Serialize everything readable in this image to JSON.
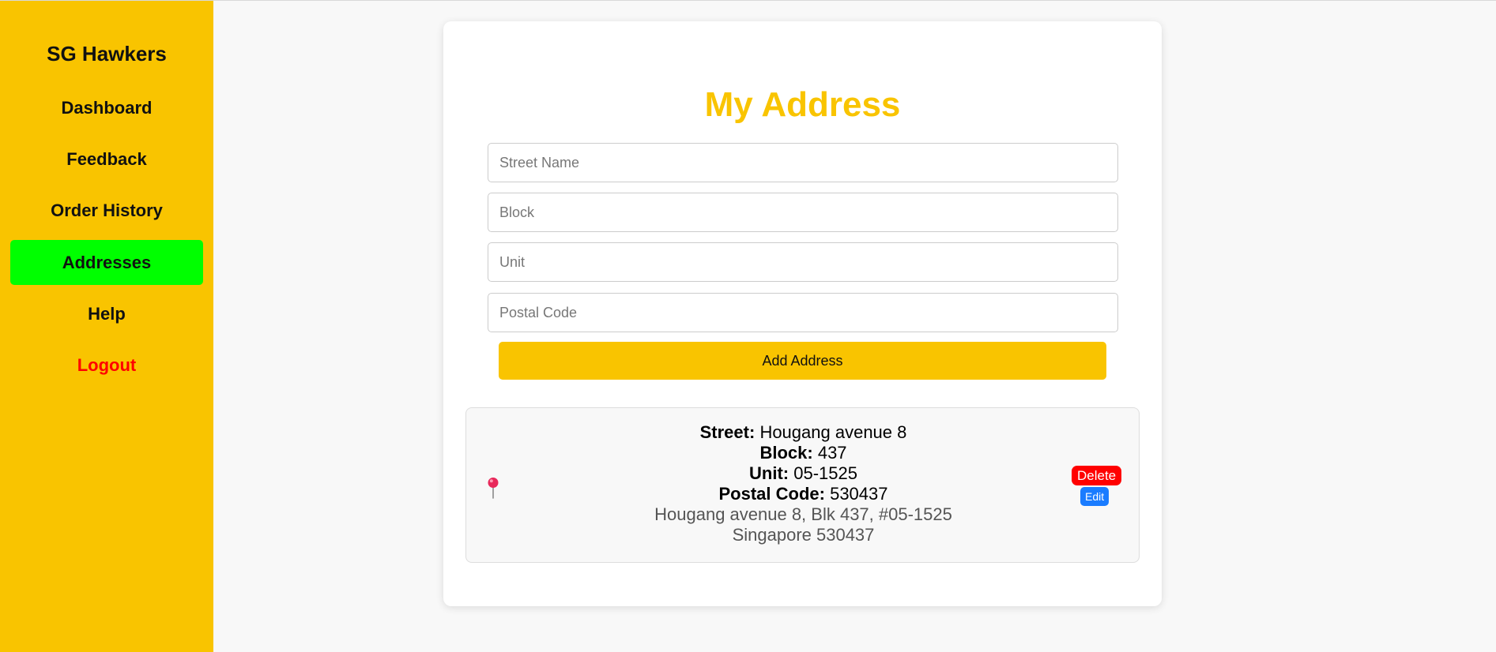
{
  "sidebar": {
    "brand": "SG Hawkers",
    "items": [
      {
        "label": "Dashboard"
      },
      {
        "label": "Feedback"
      },
      {
        "label": "Order History"
      },
      {
        "label": "Addresses",
        "active": true
      },
      {
        "label": "Help"
      },
      {
        "label": "Logout"
      }
    ]
  },
  "main": {
    "title": "My Address",
    "form": {
      "street_placeholder": "Street Name",
      "block_placeholder": "Block",
      "unit_placeholder": "Unit",
      "postal_placeholder": "Postal Code",
      "submit_label": "Add Address"
    },
    "address": {
      "icon": "round-pushpin-icon",
      "street_label": "Street:",
      "street_value": "Hougang avenue 8",
      "block_label": "Block:",
      "block_value": "437",
      "unit_label": "Unit:",
      "unit_value": "05-1525",
      "postal_label": "Postal Code:",
      "postal_value": "530437",
      "full_line1": "Hougang avenue 8, Blk 437, #05-1525",
      "full_line2": "Singapore 530437",
      "delete_label": "Delete",
      "edit_label": "Edit"
    }
  },
  "colors": {
    "sidebar_bg": "#f9c400",
    "active_bg": "#00ff00",
    "logout": "#ff0000",
    "accent": "#f9c400",
    "delete": "#ff0000",
    "edit": "#1a7cff"
  }
}
